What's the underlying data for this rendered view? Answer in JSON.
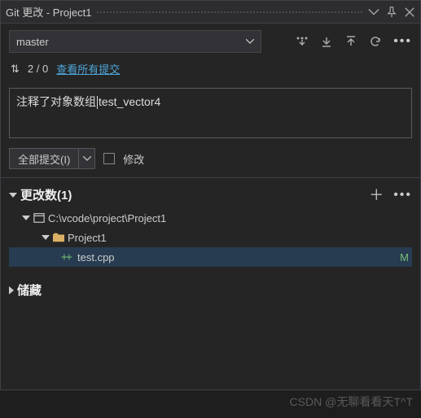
{
  "titleBar": {
    "title": "Git 更改 - Project1"
  },
  "branch": {
    "current": "master"
  },
  "status": {
    "arrows": "⇅",
    "counts": "2 / 0",
    "viewAll": "查看所有提交"
  },
  "commitMessage": {
    "before": "注释了对象数组",
    "after": "test_vector4"
  },
  "actions": {
    "commitAll": "全部提交(I)",
    "amend": "修改"
  },
  "changes": {
    "header": "更改数(1)",
    "rootPath": "C:\\vcode\\project\\Project1",
    "folder": "Project1",
    "file": "test.cpp",
    "fileStatus": "M"
  },
  "stash": {
    "header": "储藏"
  },
  "watermark": "CSDN @无聊看看天T^T"
}
